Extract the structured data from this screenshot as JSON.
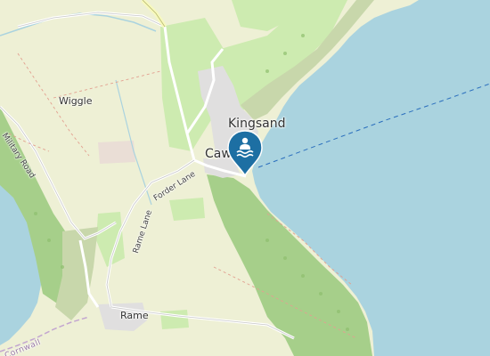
{
  "map": {
    "colors": {
      "sea": "#aad3df",
      "land": "#f2efe9",
      "farmland": "#eef0d5",
      "meadow": "#cdebb0",
      "scrub": "#c8d7ab",
      "cliff_green": "#a6cf8a",
      "urban": "#e0dfdf",
      "marker": "#1d6fa3",
      "route_line": "#2a6ebd"
    },
    "labels": {
      "kingsand": "Kingsand",
      "cawsand": "Caw",
      "wiggle": "Wiggle",
      "rame": "Rame",
      "forder_lane": "Forder Lane",
      "rame_lane": "Rame Lane",
      "military_road": "Military Road",
      "cornwall": "Cornwall"
    },
    "marker": {
      "icon": "swimming-icon",
      "name": "bathing-site-marker"
    }
  }
}
